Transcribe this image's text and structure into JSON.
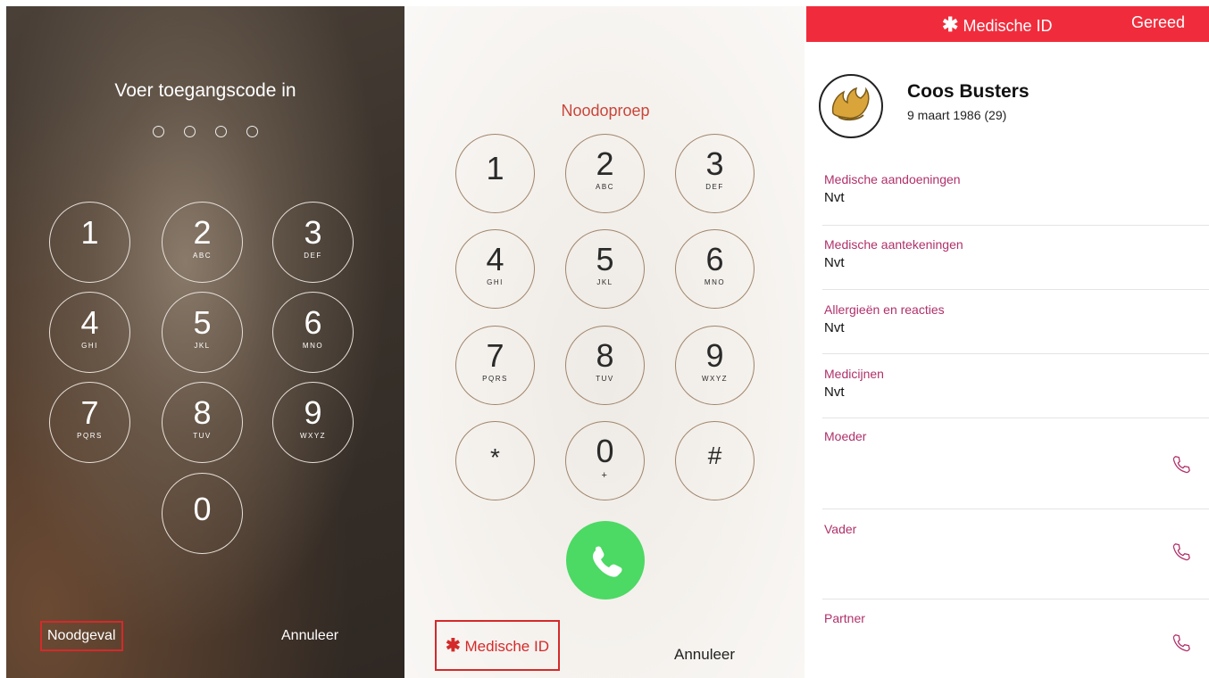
{
  "lockscreen": {
    "title": "Voer toegangscode in",
    "keys": [
      {
        "digit": "1",
        "letters": ""
      },
      {
        "digit": "2",
        "letters": "ABC"
      },
      {
        "digit": "3",
        "letters": "DEF"
      },
      {
        "digit": "4",
        "letters": "GHI"
      },
      {
        "digit": "5",
        "letters": "JKL"
      },
      {
        "digit": "6",
        "letters": "MNO"
      },
      {
        "digit": "7",
        "letters": "PQRS"
      },
      {
        "digit": "8",
        "letters": "TUV"
      },
      {
        "digit": "9",
        "letters": "WXYZ"
      },
      {
        "digit": "0",
        "letters": ""
      }
    ],
    "emergency_label": "Noodgeval",
    "cancel_label": "Annuleer"
  },
  "dialer": {
    "title": "Noodoproep",
    "keys": [
      {
        "digit": "1",
        "letters": ""
      },
      {
        "digit": "2",
        "letters": "ABC"
      },
      {
        "digit": "3",
        "letters": "DEF"
      },
      {
        "digit": "4",
        "letters": "GHI"
      },
      {
        "digit": "5",
        "letters": "JKL"
      },
      {
        "digit": "6",
        "letters": "MNO"
      },
      {
        "digit": "7",
        "letters": "PQRS"
      },
      {
        "digit": "8",
        "letters": "TUV"
      },
      {
        "digit": "9",
        "letters": "WXYZ"
      },
      {
        "digit": "*",
        "letters": ""
      },
      {
        "digit": "0",
        "letters": "+"
      },
      {
        "digit": "#",
        "letters": ""
      }
    ],
    "medical_id_star": "✱",
    "medical_id_label": "Medische ID",
    "cancel_label": "Annuleer",
    "call_icon": "phone-icon"
  },
  "medical_id": {
    "header_star": "✱",
    "header_title": "Medische ID",
    "done_label": "Gereed",
    "name": "Coos Busters",
    "birthdate": "9 maart 1986 (29)",
    "sections": [
      {
        "label": "Medische aandoeningen",
        "value": "Nvt"
      },
      {
        "label": "Medische aantekeningen",
        "value": "Nvt"
      },
      {
        "label": "Allergieën en reacties",
        "value": "Nvt"
      },
      {
        "label": "Medicijnen",
        "value": "Nvt"
      }
    ],
    "contacts": [
      {
        "label": "Moeder"
      },
      {
        "label": "Vader"
      },
      {
        "label": "Partner"
      }
    ],
    "colors": {
      "header": "#f02c3c",
      "label": "#b0306a",
      "call_green": "#4cd964",
      "emergency_red": "#d42a2a"
    }
  }
}
